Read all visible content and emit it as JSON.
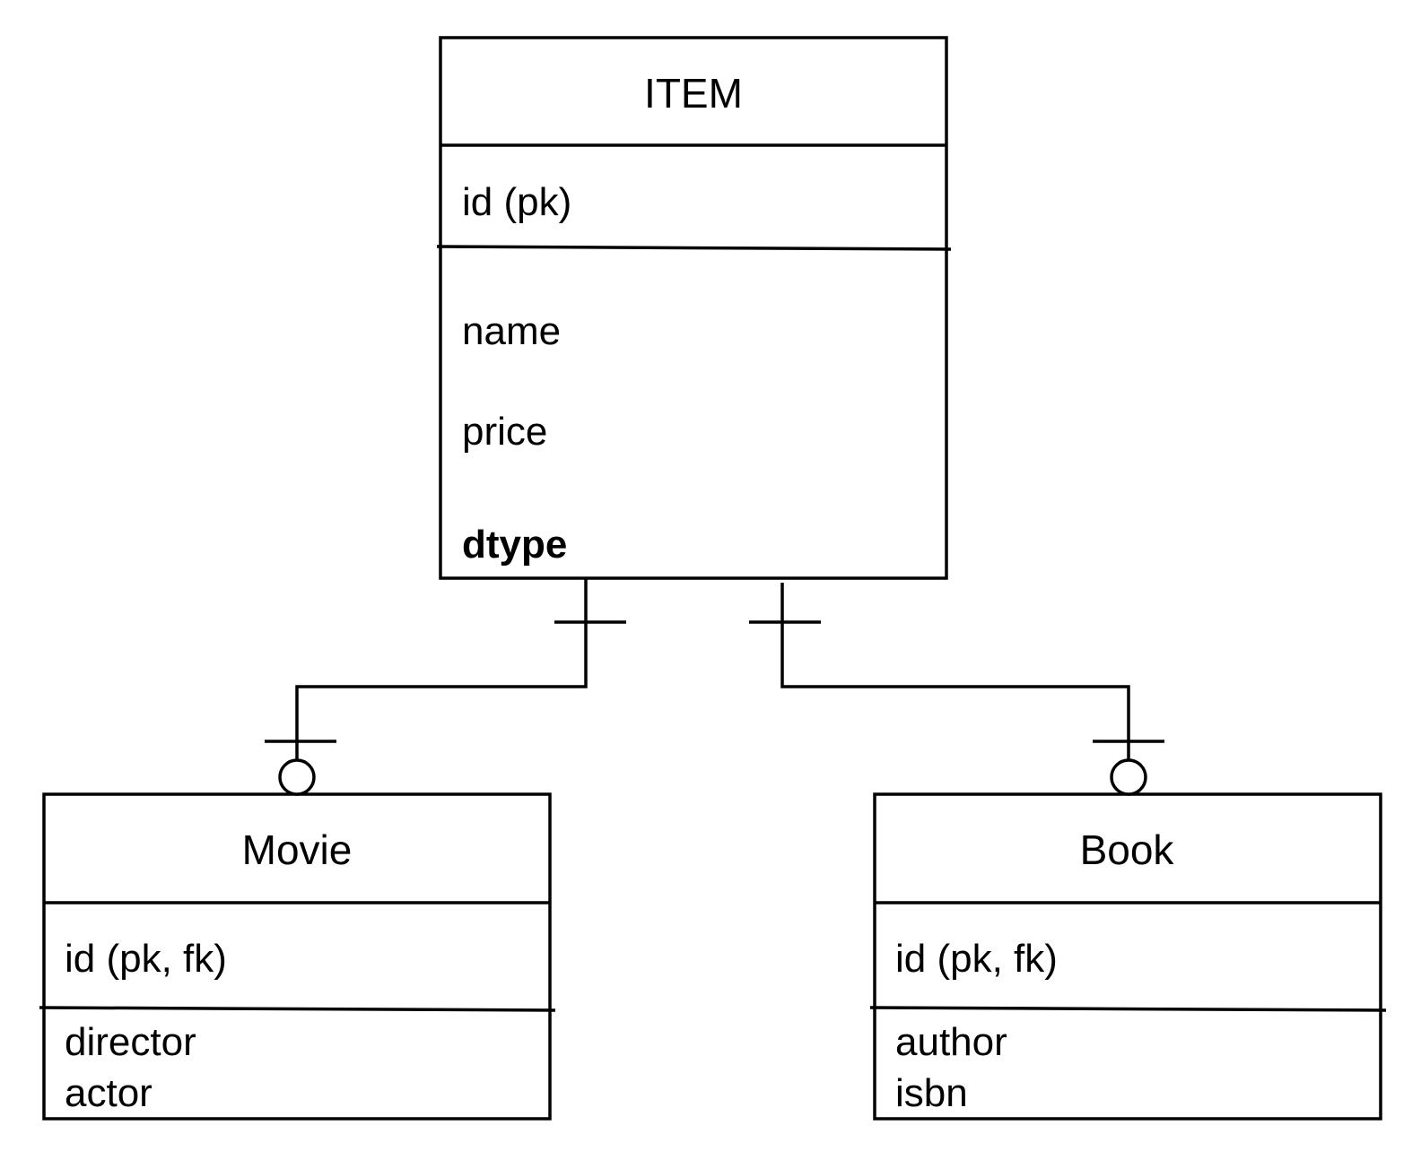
{
  "entities": {
    "item": {
      "title": "ITEM",
      "key": "id (pk)",
      "attributes": [
        "name",
        "price"
      ],
      "discriminator": "dtype"
    },
    "movie": {
      "title": "Movie",
      "key": "id (pk, fk)",
      "attributes": [
        "director",
        "actor"
      ]
    },
    "book": {
      "title": "Book",
      "key": "id (pk, fk)",
      "attributes": [
        "author",
        "isbn"
      ]
    }
  },
  "relationships": [
    {
      "from": "ITEM",
      "to": "Movie",
      "from_cardinality": "one",
      "to_cardinality": "zero-or-one"
    },
    {
      "from": "ITEM",
      "to": "Book",
      "from_cardinality": "one",
      "to_cardinality": "zero-or-one"
    }
  ]
}
